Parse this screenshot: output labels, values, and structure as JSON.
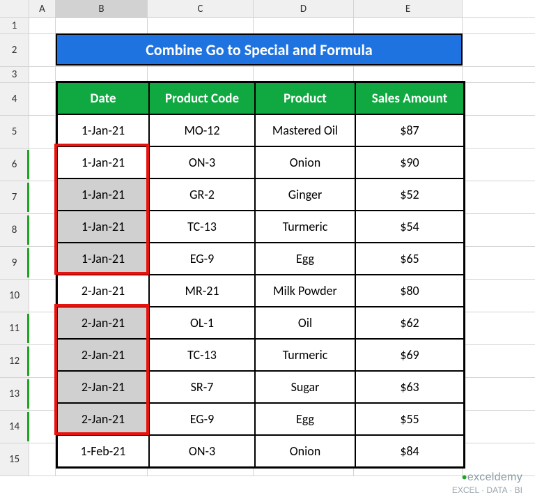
{
  "columns": {
    "A": "A",
    "B": "B",
    "C": "C",
    "D": "D",
    "E": "E"
  },
  "row_labels": [
    "1",
    "2",
    "3",
    "4",
    "5",
    "6",
    "7",
    "8",
    "9",
    "10",
    "11",
    "12",
    "13",
    "14",
    "15"
  ],
  "active_column": "B",
  "green_rows": [
    6,
    7,
    8,
    9,
    11,
    12,
    13,
    14
  ],
  "title": "Combine Go to Special and Formula",
  "table": {
    "headers": {
      "date": "Date",
      "code": "Product Code",
      "product": "Product",
      "amount": "Sales Amount"
    },
    "currency_symbol": "$",
    "rows": [
      {
        "date": "1-Jan-21",
        "code": "MO-12",
        "product": "Mastered Oil",
        "amount": "87",
        "grey": false
      },
      {
        "date": "1-Jan-21",
        "code": "ON-3",
        "product": "Onion",
        "amount": "90",
        "grey": false
      },
      {
        "date": "1-Jan-21",
        "code": "GR-2",
        "product": "Ginger",
        "amount": "52",
        "grey": true
      },
      {
        "date": "1-Jan-21",
        "code": "TC-13",
        "product": "Turmeric",
        "amount": "54",
        "grey": true
      },
      {
        "date": "1-Jan-21",
        "code": "EG-9",
        "product": "Egg",
        "amount": "65",
        "grey": true
      },
      {
        "date": "2-Jan-21",
        "code": "MR-21",
        "product": "Milk Powder",
        "amount": "80",
        "grey": false
      },
      {
        "date": "2-Jan-21",
        "code": "OL-1",
        "product": "Oil",
        "amount": "62",
        "grey": true
      },
      {
        "date": "2-Jan-21",
        "code": "TC-13",
        "product": "Turmeric",
        "amount": "69",
        "grey": true
      },
      {
        "date": "2-Jan-21",
        "code": "SR-7",
        "product": "Sugar",
        "amount": "63",
        "grey": true
      },
      {
        "date": "2-Jan-21",
        "code": "EG-9",
        "product": "Egg",
        "amount": "55",
        "grey": true
      },
      {
        "date": "1-Feb-21",
        "code": "ON-3",
        "product": "Onion",
        "amount": "84",
        "grey": false
      }
    ]
  },
  "red_boxes": [
    {
      "start_row_index": 1,
      "rows": 4
    },
    {
      "start_row_index": 6,
      "rows": 4
    }
  ],
  "watermark": {
    "brand_left": "exceldemy",
    "tagline": "EXCEL · DATA · BI"
  },
  "chart_data": {
    "type": "table",
    "title": "Combine Go to Special and Formula",
    "columns": [
      "Date",
      "Product Code",
      "Product",
      "Sales Amount"
    ],
    "rows": [
      [
        "1-Jan-21",
        "MO-12",
        "Mastered Oil",
        87
      ],
      [
        "1-Jan-21",
        "ON-3",
        "Onion",
        90
      ],
      [
        "1-Jan-21",
        "GR-2",
        "Ginger",
        52
      ],
      [
        "1-Jan-21",
        "TC-13",
        "Turmeric",
        54
      ],
      [
        "1-Jan-21",
        "EG-9",
        "Egg",
        65
      ],
      [
        "2-Jan-21",
        "MR-21",
        "Milk Powder",
        80
      ],
      [
        "2-Jan-21",
        "OL-1",
        "Oil",
        62
      ],
      [
        "2-Jan-21",
        "TC-13",
        "Turmeric",
        69
      ],
      [
        "2-Jan-21",
        "SR-7",
        "Sugar",
        63
      ],
      [
        "2-Jan-21",
        "EG-9",
        "Egg",
        55
      ],
      [
        "1-Feb-21",
        "ON-3",
        "Onion",
        84
      ]
    ]
  }
}
